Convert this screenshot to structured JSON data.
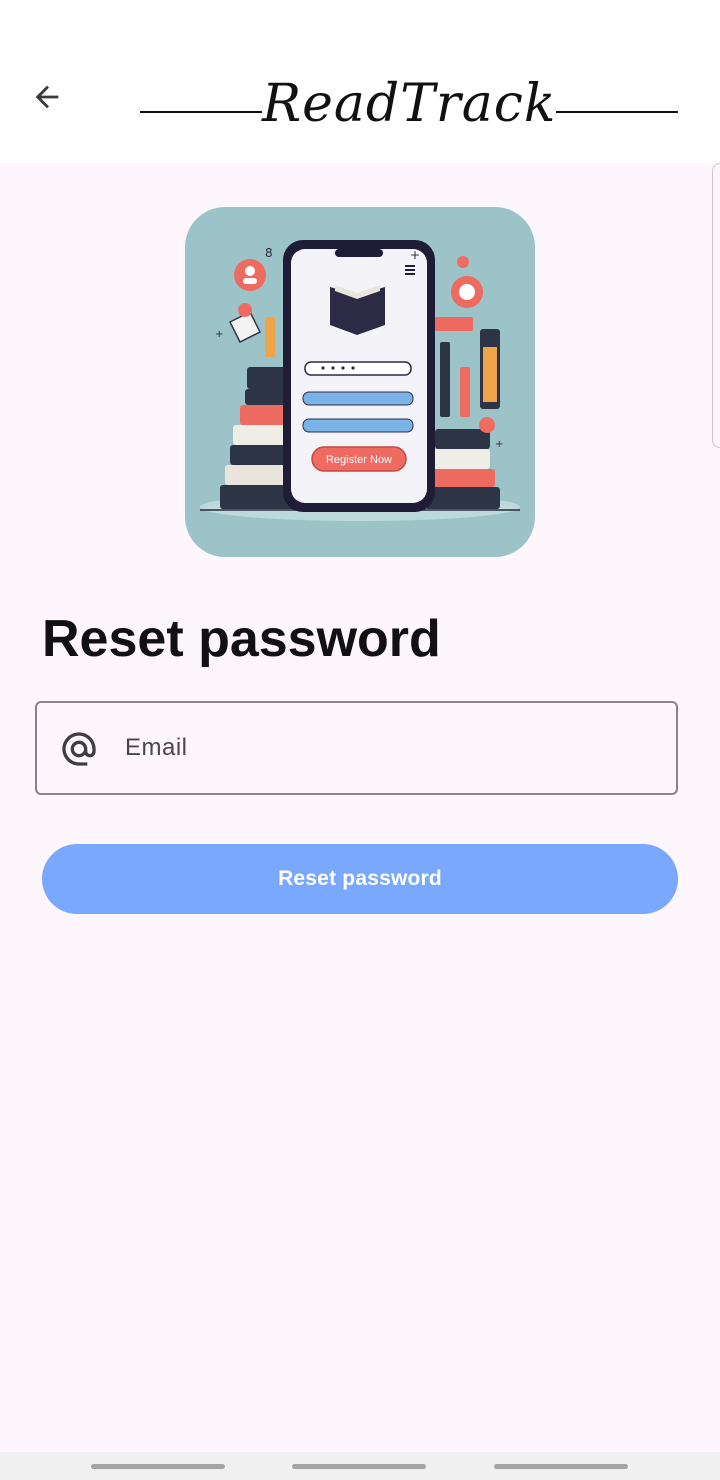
{
  "header": {
    "back_icon": "arrow-left-icon",
    "brand_title": "ReadTrack"
  },
  "illustration": {
    "description_icon": "books-and-phone-illustration",
    "phone_button_label": "Register Now"
  },
  "main": {
    "title": "Reset password",
    "email_field": {
      "icon": "at-sign-icon",
      "placeholder": "Email",
      "value": ""
    },
    "reset_button_label": "Reset password"
  },
  "colors": {
    "background": "#fdf7fd",
    "accent": "#7aa8ff",
    "illustration_bg": "#9bc3c8"
  }
}
